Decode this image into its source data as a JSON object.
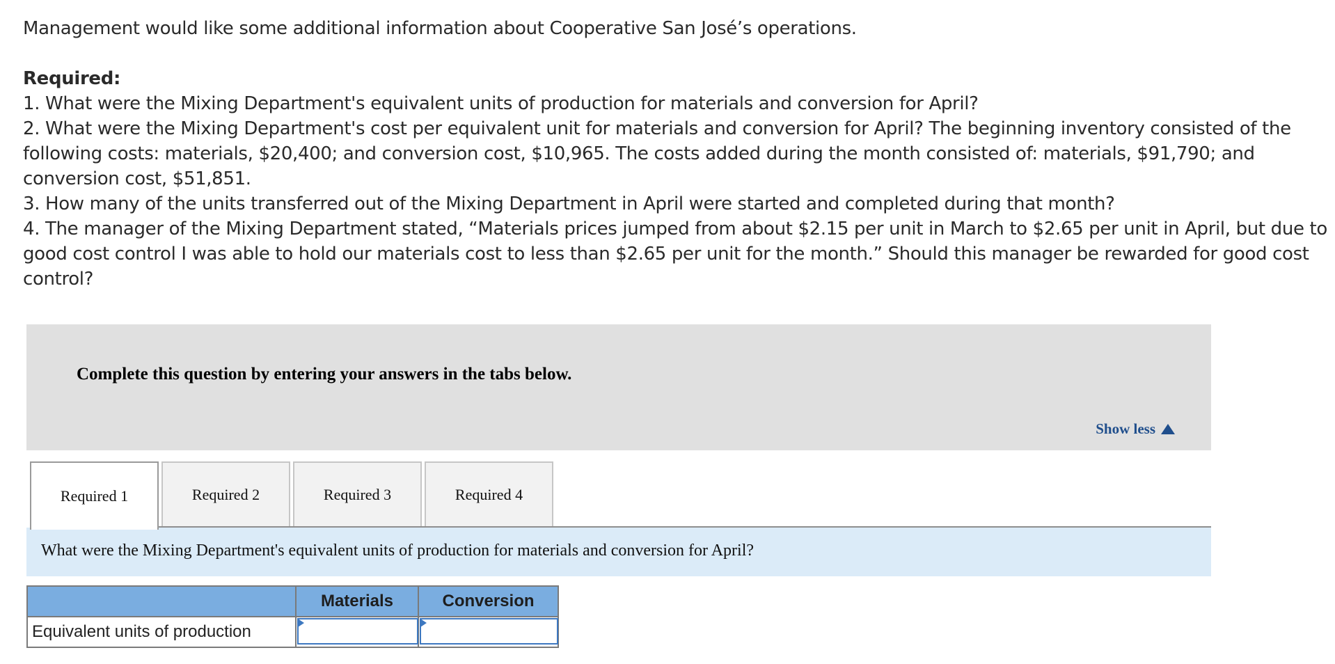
{
  "intro": {
    "lead": "Management would like some additional information about Cooperative San José’s operations.",
    "required_heading": "Required:",
    "items": [
      "1. What were the Mixing Department's equivalent units of production for materials and conversion for April?",
      "2. What were the Mixing Department's cost per equivalent unit for materials and conversion for April? The beginning inventory consisted of the following costs: materials, $20,400; and conversion cost, $10,965. The costs added during the month consisted of: materials, $91,790; and conversion cost, $51,851.",
      "3. How many of the units transferred out of the Mixing Department in April were started and completed during that month?",
      "4. The manager of the Mixing Department stated, “Materials prices jumped from about $2.15 per unit in March to $2.65 per unit in April, but due to good cost control I was able to hold our materials cost to less than $2.65 per unit for the month.” Should this manager be rewarded for good cost control?"
    ]
  },
  "instructions": {
    "text": "Complete this question by entering your answers in the tabs below.",
    "toggle_label": "Show less",
    "toggle_icon": "triangle-up-icon"
  },
  "tabs": [
    {
      "label": "Required 1",
      "active": true
    },
    {
      "label": "Required 2",
      "active": false
    },
    {
      "label": "Required 3",
      "active": false
    },
    {
      "label": "Required 4",
      "active": false
    }
  ],
  "question": "What were the Mixing Department's equivalent units of production for materials and conversion for April?",
  "table": {
    "headers": [
      "",
      "Materials",
      "Conversion"
    ],
    "rows": [
      {
        "label": "Equivalent units of production",
        "materials": "",
        "conversion": ""
      }
    ]
  },
  "colors": {
    "link": "#1f4e8c",
    "header_bg": "#7aade0",
    "question_band": "#dbebf8",
    "instructions_bg": "#e0e0e0",
    "input_border": "#3d78c0"
  }
}
